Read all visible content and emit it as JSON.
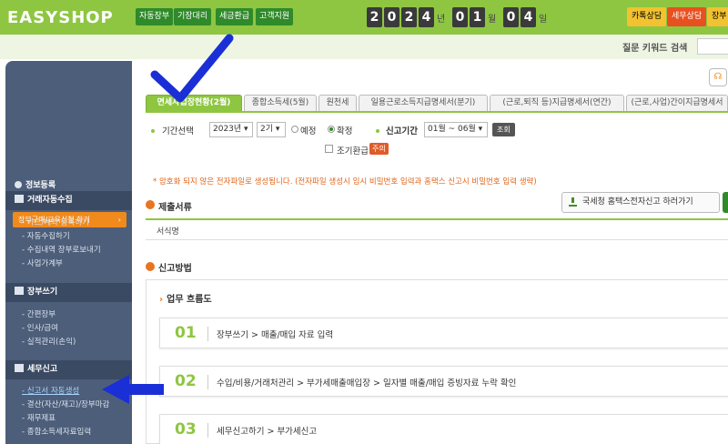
{
  "header": {
    "logo": "EASYSHOP",
    "nav": [
      "자동장부",
      "기장대리",
      "세금환급",
      "고객지원"
    ],
    "date": {
      "year_digits": [
        "2",
        "0",
        "2",
        "4"
      ],
      "year_unit": "년",
      "month_digits": [
        "0",
        "1"
      ],
      "month_unit": "월",
      "day_digits": [
        "0",
        "4"
      ],
      "day_unit": "일"
    },
    "right_buttons": [
      "카톡상담",
      "세무상담",
      "장부"
    ],
    "right_colors": [
      "#f2c230",
      "#e8501f",
      "#f2c230"
    ]
  },
  "search": {
    "label": "질문 키워드 검색"
  },
  "sidebar": {
    "promo_button": "장부구매/교육신청 하기",
    "promo_arrow": "›",
    "sections": [
      {
        "title": "정보등록",
        "items": []
      },
      {
        "title": "거래자동수집",
        "items": [
          "카드/계좌 등록하기",
          "자동수집하기",
          "수집내역 장부로보내기",
          "사업가계부"
        ]
      },
      {
        "title": "장부쓰기",
        "items": [
          "간편장부",
          "인사/급여",
          "실적관리(손익)"
        ]
      },
      {
        "title": "세무신고",
        "items": [
          "신고서 자동생성",
          "결산(자산/재고)/장부마감",
          "재무제표",
          "종합소득세자료입력"
        ]
      }
    ]
  },
  "tabs": [
    "면세사업장현황(2월)",
    "종합소득세(5월)",
    "원천세",
    "일용근로소득지급명세서(분기)",
    "(근로,퇴직 등)지급명세서(연간)",
    "(근로,사업)간이지급명세서"
  ],
  "filters": {
    "period_label": "기간선택",
    "year_value": "2023년",
    "term_value": "2기",
    "radio_estimate": "예정",
    "radio_final": "확정",
    "report_period_label": "신고기간",
    "report_period_value": "01월 ~ 06월",
    "query_button": "조회",
    "early_refund_label": "조기환급",
    "early_refund_badge": "주의"
  },
  "notice": "* 암호화 되지 않은 전자파일로 생성됩니다. (전자파일 생성시 임시 비밀번호 입력과 홈택스 신고시 비밀번호 입력 생략)",
  "submit_docs": {
    "title": "제출서류",
    "hometax_button": "국세청 홈택스전자신고 하러가기",
    "column_header": "서식명"
  },
  "report_method": {
    "title": "신고방법",
    "flow_title": "업무 흐름도",
    "flow_chevron": "›",
    "steps": [
      {
        "num": "01",
        "text": "장부쓰기 > 매출/매입 자료 입력"
      },
      {
        "num": "02",
        "text": "수입/비용/거래처관리 > 부가세매출매입장 > 일자별 매출/매입 증빙자료 누락 확인"
      },
      {
        "num": "03",
        "text": "세무신고하기 > 부가세신고"
      }
    ]
  },
  "help_icon": "headset-icon"
}
